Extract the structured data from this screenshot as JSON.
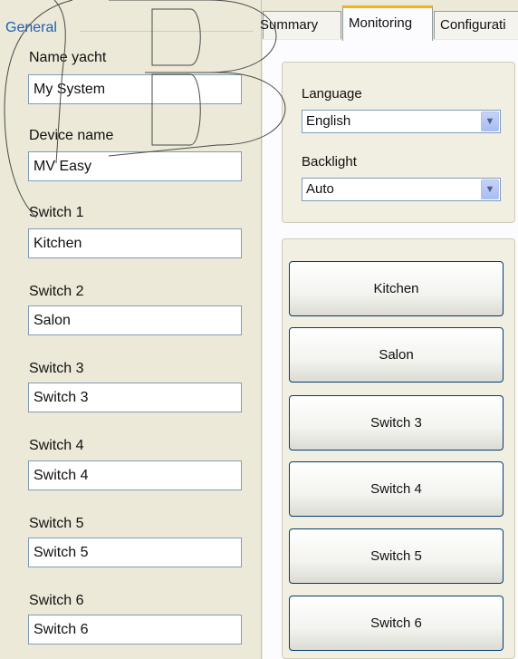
{
  "left_panel": {
    "group_title": "General",
    "fields": [
      {
        "label": "Name yacht",
        "value": "My System"
      },
      {
        "label": "Device name",
        "value": "MV Easy"
      },
      {
        "label": "Switch 1",
        "value": "Kitchen"
      },
      {
        "label": "Switch 2",
        "value": "Salon"
      },
      {
        "label": "Switch 3",
        "value": "Switch 3"
      },
      {
        "label": "Switch 4",
        "value": "Switch 4"
      },
      {
        "label": "Switch 5",
        "value": "Switch 5"
      },
      {
        "label": "Switch 6",
        "value": "Switch 6"
      }
    ]
  },
  "tabs": [
    "Summary",
    "Monitoring",
    "Configurati"
  ],
  "active_tab": "Monitoring",
  "settings": {
    "language_label": "Language",
    "language_value": "English",
    "backlight_label": "Backlight",
    "backlight_value": "Auto"
  },
  "switch_buttons": [
    "Kitchen",
    "Salon",
    "Switch 3",
    "Switch 4",
    "Switch 5",
    "Switch 6"
  ],
  "icons": {
    "dropdown": "chevron-down-icon"
  },
  "colors": {
    "group_title": "#1c5fb8",
    "tab_highlight": "#f9b119",
    "button_border": "#003c74"
  }
}
